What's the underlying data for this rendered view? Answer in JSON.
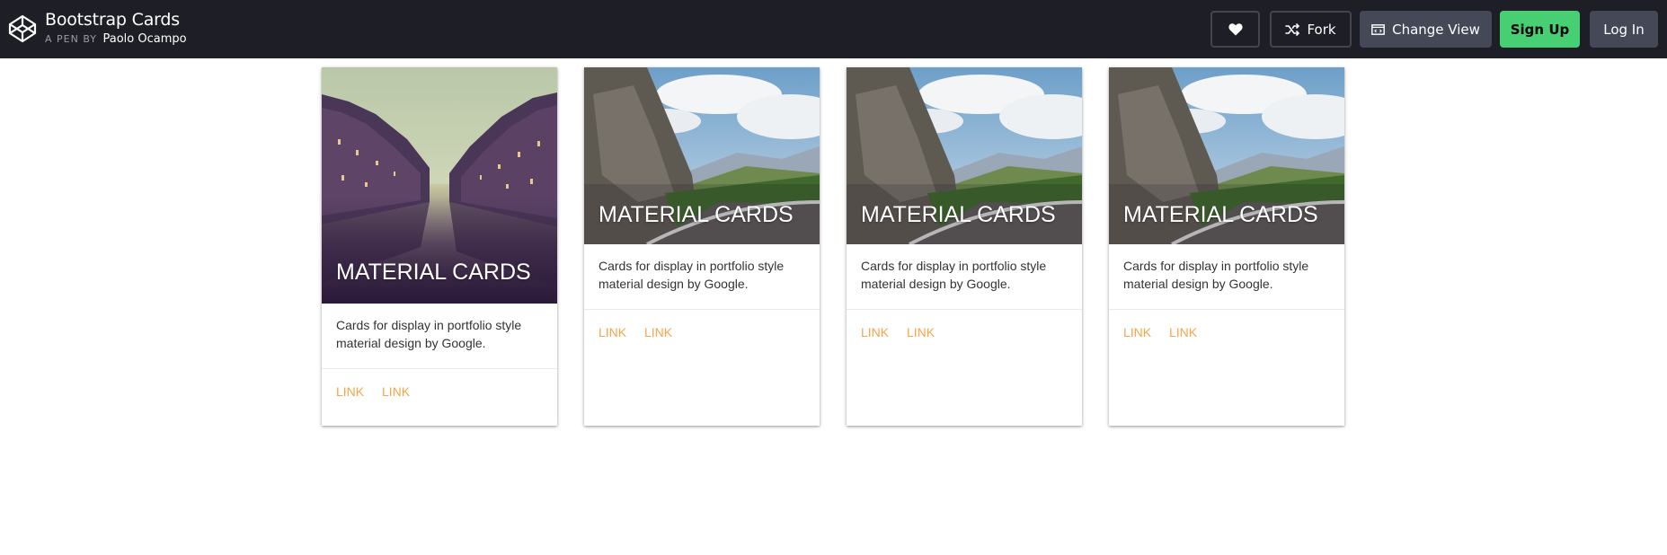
{
  "header": {
    "title": "Bootstrap Cards",
    "byline_prefix": "A PEN BY",
    "author": "Paolo Ocampo",
    "fork_label": "Fork",
    "change_view_label": "Change View",
    "signup_label": "Sign Up",
    "login_label": "Log In",
    "icons": [
      "codepen-logo-icon",
      "heart-icon",
      "fork-icon",
      "change-view-icon"
    ]
  },
  "cards": [
    {
      "image": "canal-city-image",
      "title": "MATERIAL CARDS",
      "text": "Cards for display in portfolio style material design by Google.",
      "links": [
        "LINK",
        "LINK"
      ]
    },
    {
      "image": "mountain-road-image",
      "title": "MATERIAL CARDS",
      "text": "Cards for display in portfolio style material design by Google.",
      "links": [
        "LINK",
        "LINK"
      ]
    },
    {
      "image": "mountain-road-image",
      "title": "MATERIAL CARDS",
      "text": "Cards for display in portfolio style material design by Google.",
      "links": [
        "LINK",
        "LINK"
      ]
    },
    {
      "image": "mountain-road-image",
      "title": "MATERIAL CARDS",
      "text": "Cards for display in portfolio style material design by Google.",
      "links": [
        "LINK",
        "LINK"
      ]
    }
  ],
  "colors": {
    "header_bg": "#1e1f26",
    "button_gray": "#444857",
    "signup_green": "#47cf73",
    "link_orange": "#f5a549"
  }
}
